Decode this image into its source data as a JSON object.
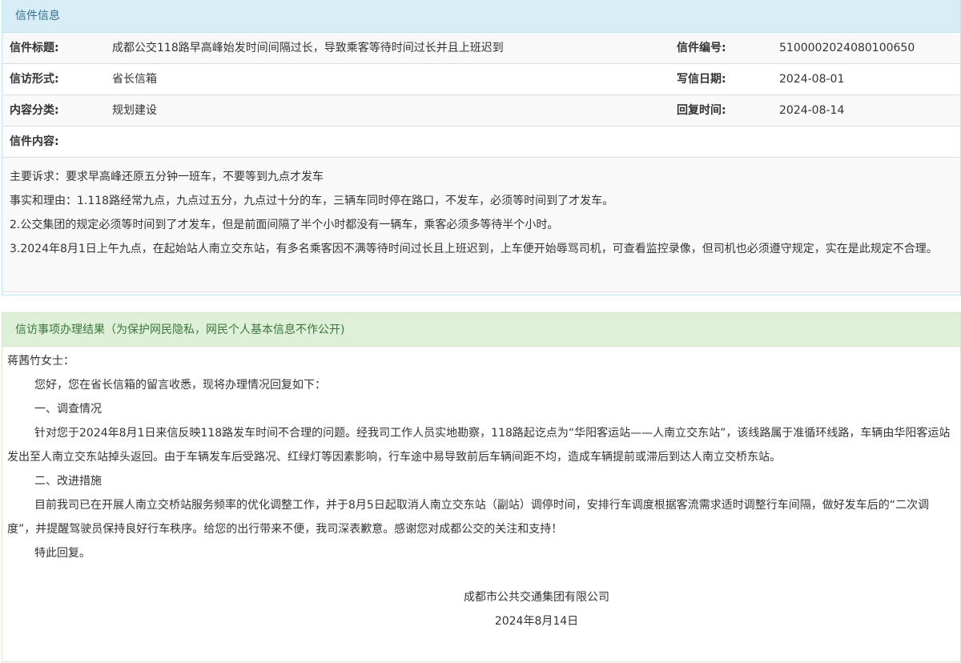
{
  "letter_info": {
    "heading": "信件信息",
    "title_label": "信件标题:",
    "title_value": "成都公交118路早高峰始发时间间隔过长，导致乘客等待时间过长并且上班迟到",
    "number_label": "信件编号:",
    "number_value": "510000202408010065 0",
    "form_label": "信访形式:",
    "form_value": "省长信箱",
    "write_date_label": "写信日期:",
    "write_date_value": "2024-08-01",
    "category_label": "内容分类:",
    "category_value": "规划建设",
    "reply_time_label": "回复时间:",
    "reply_time_value": "2024-08-14",
    "content_label": "信件内容:",
    "content_lines": [
      "主要诉求：要求早高峰还原五分钟一班车，不要等到九点才发车",
      "事实和理由：1.118路经常九点，九点过五分，九点过十分的车，三辆车同时停在路口，不发车，必须等时间到了才发车。",
      "2.公交集团的规定必须等时间到了才发车，但是前面间隔了半个小时都没有一辆车，乘客必须多等待半个小时。",
      "3.2024年8月1日上午九点，在起始站人南立交东站，有多名乘客因不满等待时间过长且上班迟到，上车便开始辱骂司机，可查看监控录像，但司机也必须遵守规定，实在是此规定不合理。"
    ]
  },
  "result": {
    "heading": "信访事项办理结果（为保护网民隐私，网民个人基本信息不作公开)",
    "salutation": "蒋茜竹女士：",
    "greeting": "您好，您在省长信箱的留言收悉，现将办理情况回复如下：",
    "section1_title": "一、调查情况",
    "section1_body": "针对您于2024年8月1日来信反映118路发车时间不合理的问题。经我司工作人员实地勘察，118路起讫点为“华阳客运站——人南立交东站”，该线路属于准循环线路，车辆由华阳客运站发出至人南立交东站掉头返回。由于车辆发车后受路况、红绿灯等因素影响，行车途中易导致前后车辆间距不均，造成车辆提前或滞后到达人南立交桥东站。",
    "section2_title": "二、改进措施",
    "section2_body": "目前我司已在开展人南立交桥站服务频率的优化调整工作，并于8月5日起取消人南立交东站（副站）调停时间，安排行车调度根据客流需求适时调整行车间隔，做好发车后的“二次调度”，并提醒驾驶员保持良好行车秩序。给您的出行带来不便，我司深表歉意。感谢您对成都公交的关注和支持！",
    "closing": "特此回复。",
    "signature": "成都市公共交通集团有限公司",
    "sign_date": "2024年8月14日"
  }
}
